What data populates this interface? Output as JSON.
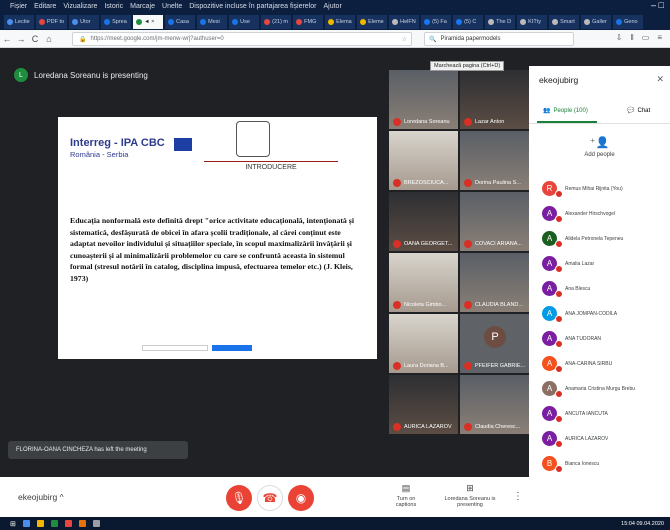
{
  "menubar": {
    "items": [
      "Fișier",
      "Editare",
      "Vizualizare",
      "Istoric",
      "Marcaje",
      "Unelte",
      "Dispozitive incluse în partajarea fișierelor",
      "Ajutor"
    ]
  },
  "tabs": [
    {
      "label": "Lectie",
      "color": "#4a8ef0"
    },
    {
      "label": "PDF to",
      "color": "#e8453c"
    },
    {
      "label": "Utor",
      "color": "#4a8ef0"
    },
    {
      "label": "Sprea",
      "color": "#1a73e8"
    },
    {
      "label": "◄ ×",
      "color": "#1e8e3e",
      "active": true
    },
    {
      "label": "Casa",
      "color": "#1a73e8"
    },
    {
      "label": "Mesi",
      "color": "#1a73e8"
    },
    {
      "label": "Use",
      "color": "#1a73e8"
    },
    {
      "label": "(21) m",
      "color": "#e8453c"
    },
    {
      "label": "FMG",
      "color": "#e8453c"
    },
    {
      "label": "Elema",
      "color": "#f4b400"
    },
    {
      "label": "Eleme",
      "color": "#f4b400"
    },
    {
      "label": "HelFN",
      "color": "#bbb"
    },
    {
      "label": "(5) Fa",
      "color": "#1877f2"
    },
    {
      "label": "(5) C",
      "color": "#1877f2"
    },
    {
      "label": "The D",
      "color": "#bbb"
    },
    {
      "label": "KITty",
      "color": "#bbb"
    },
    {
      "label": "Smart",
      "color": "#bbb"
    },
    {
      "label": "Galler",
      "color": "#bbb"
    },
    {
      "label": "Geno",
      "color": "#1a73e8"
    }
  ],
  "toolbar": {
    "back": "←",
    "forward": "→",
    "reload": "C",
    "home": "⌂",
    "url": "https://meet.google.com/jm-menw-wrj?authuser=0",
    "search_value": "Piramida papermodels",
    "tooltip": "Marchează pagina (Ctrl+D)"
  },
  "presenter": {
    "initial": "L",
    "label": "Loredana Soreanu is presenting"
  },
  "slide": {
    "brand": "Interreg - IPA CBC",
    "subbrand": "România - Serbia",
    "section": "INTRODUCERE",
    "body": "Educația nonformală este definită drept \"orice activitate educațională, intenționată și sistematică, desfășurată de obicei în afara școlii tradiționale, al cărei conținut este adaptat nevoilor individului și situațiilor speciale, în scopul maximalizării învățării și cunoașterii și al minimalizării problemelor cu care se confruntă aceasta în sistemul formal (stresul notării în catalog, disciplina impusă, efectuarea temelor etc.) (J. Kleis, 1973)"
  },
  "tiles": [
    {
      "name": "Loredana Soreanu",
      "style": "photo"
    },
    {
      "name": "Lazar Anton",
      "style": "dark"
    },
    {
      "name": "BREZOSCIUCA...",
      "style": "light"
    },
    {
      "name": "Dorina Paulina S...",
      "style": "photo"
    },
    {
      "name": "OANA GEORGET...",
      "style": "dark"
    },
    {
      "name": "COVACI ARIANA...",
      "style": "photo"
    },
    {
      "name": "Nicoleta Gimbo...",
      "style": "light"
    },
    {
      "name": "CLAUDIA BLAND...",
      "style": "photo"
    },
    {
      "name": "Laura Doriana B...",
      "style": "light"
    },
    {
      "name": "PFEIFER GABRIE...",
      "style": "blank",
      "initial": "P"
    },
    {
      "name": "AURICA LAZAROV",
      "style": "dark"
    },
    {
      "name": "Claudia Cheresc...",
      "style": "photo"
    }
  ],
  "toast": "FLORINA-OANA CINCHEZA has left the meeting",
  "bottom": {
    "meeting_code": "ekeojubirg",
    "captions_label": "Turn on captions",
    "presenting_label": "Loredana Soreanu is presenting"
  },
  "panel": {
    "title": "ekeojubirg",
    "tab_people": "People (100)",
    "tab_chat": "Chat",
    "add_people": "Add people",
    "participants": [
      {
        "initial": "R",
        "name": "Remus Mihai Rijnita (You)",
        "color": "#e8453c"
      },
      {
        "initial": "A",
        "name": "Alexander Hirschvogel",
        "color": "#7b1fa2"
      },
      {
        "initial": "A",
        "name": "Alidela Petronela Tepeneu",
        "color": "#1b5e20"
      },
      {
        "initial": "A",
        "name": "Amalia Lazar",
        "color": "#7b1fa2"
      },
      {
        "initial": "A",
        "name": "Ana Blescu",
        "color": "#7b1fa2"
      },
      {
        "initial": "A",
        "name": "ANA JOMPAN-CODILA",
        "color": "#039be5"
      },
      {
        "initial": "A",
        "name": "ANA TUDORAN",
        "color": "#7b1fa2"
      },
      {
        "initial": "A",
        "name": "ANA-CARINA SIRBU",
        "color": "#f4511e"
      },
      {
        "initial": "A",
        "name": "Anamaria Cristina Murgu Brebu",
        "color": "#8d6e63"
      },
      {
        "initial": "A",
        "name": "ANCUTA IANCUTA",
        "color": "#7b1fa2"
      },
      {
        "initial": "A",
        "name": "AURICA LAZAROV",
        "color": "#7b1fa2"
      },
      {
        "initial": "B",
        "name": "Bianca Ionescu",
        "color": "#f4511e"
      }
    ]
  },
  "taskbar": {
    "time": "15:04",
    "date": "09.04.2020"
  }
}
